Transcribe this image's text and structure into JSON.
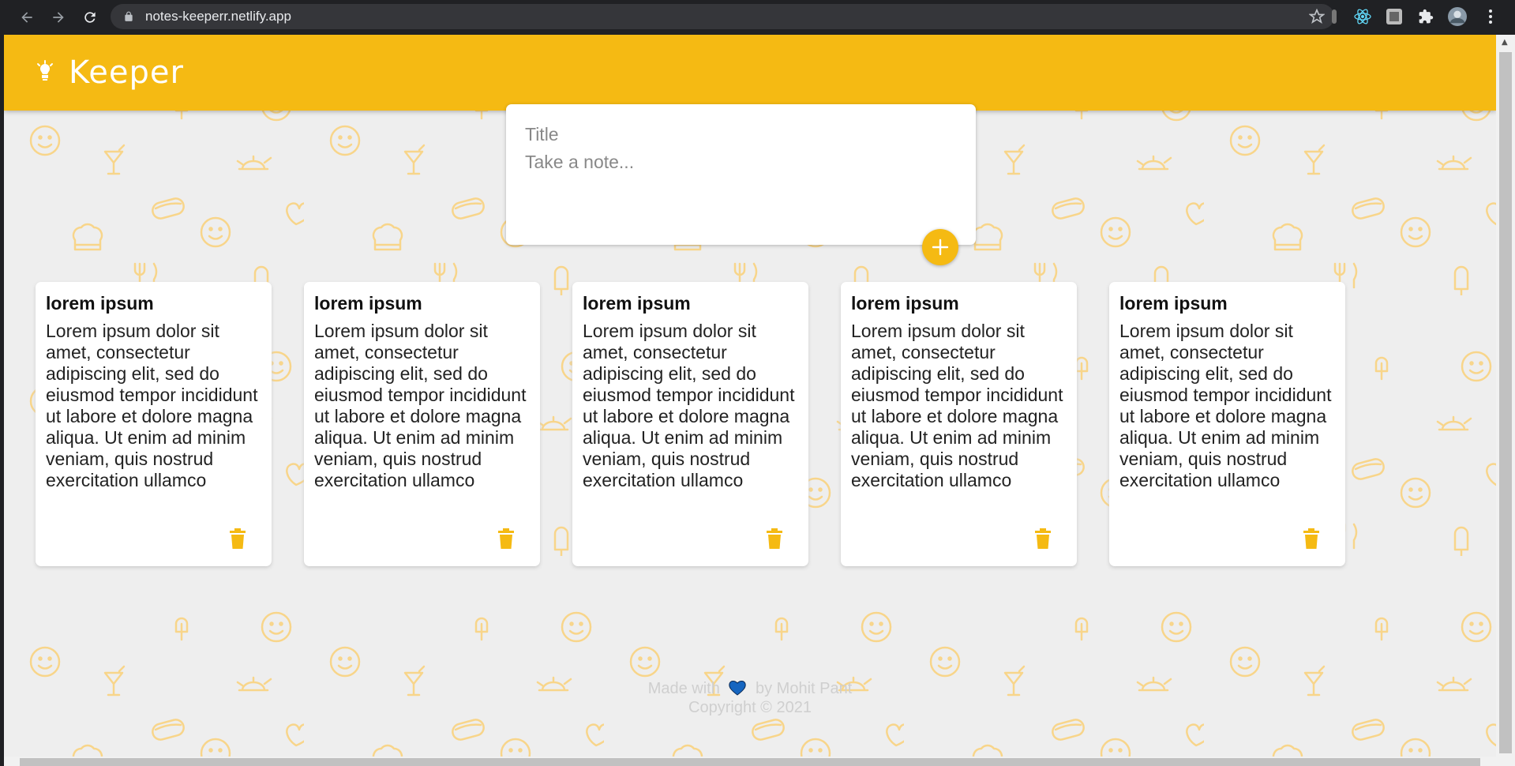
{
  "browser": {
    "url": "notes-keeperr.netlify.app"
  },
  "app": {
    "title": "Keeper",
    "accent_color": "#f5ba13",
    "background_color": "#eeeeee"
  },
  "create_area": {
    "title_placeholder": "Title",
    "content_placeholder": "Take a note...",
    "add_button_icon": "plus-icon"
  },
  "notes": [
    {
      "title": "lorem ipsum",
      "content": "Lorem ipsum dolor sit amet, consectetur adipiscing elit, sed do eiusmod tempor incididunt ut labore et dolore magna aliqua. Ut enim ad minim veniam, quis nostrud exercitation ullamco",
      "delete_icon": "trash-icon"
    },
    {
      "title": "lorem ipsum",
      "content": "Lorem ipsum dolor sit amet, consectetur adipiscing elit, sed do eiusmod tempor incididunt ut labore et dolore magna aliqua. Ut enim ad minim veniam, quis nostrud exercitation ullamco",
      "delete_icon": "trash-icon"
    },
    {
      "title": "lorem ipsum",
      "content": "Lorem ipsum dolor sit amet, consectetur adipiscing elit, sed do eiusmod tempor incididunt ut labore et dolore magna aliqua. Ut enim ad minim veniam, quis nostrud exercitation ullamco",
      "delete_icon": "trash-icon"
    },
    {
      "title": "lorem ipsum",
      "content": "Lorem ipsum dolor sit amet, consectetur adipiscing elit, sed do eiusmod tempor incididunt ut labore et dolore magna aliqua. Ut enim ad minim veniam, quis nostrud exercitation ullamco",
      "delete_icon": "trash-icon"
    },
    {
      "title": "lorem ipsum",
      "content": "Lorem ipsum dolor sit amet, consectetur adipiscing elit, sed do eiusmod tempor incididunt ut labore et dolore magna aliqua. Ut enim ad minim veniam, quis nostrud exercitation ullamco",
      "delete_icon": "trash-icon"
    }
  ],
  "footer": {
    "made_with": "Made with",
    "by": "by Mohit Pant",
    "copyright": "Copyright © 2021",
    "heart_color": "#1565c0"
  }
}
